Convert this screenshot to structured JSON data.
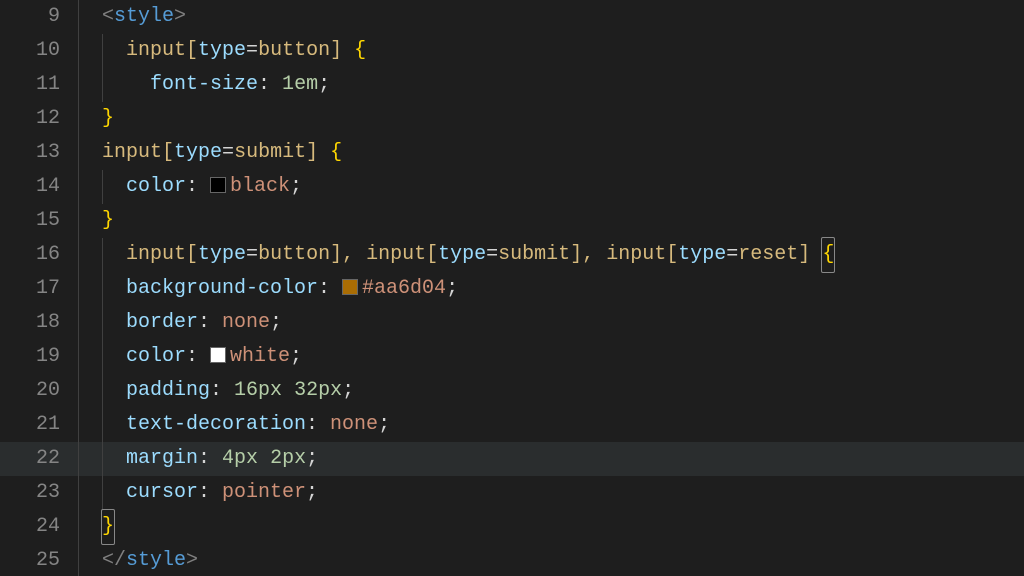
{
  "editor": {
    "activeLine": 22,
    "colors": {
      "bg": "#1e1e1e",
      "gutter": "#858585",
      "tag": "#808080",
      "tagname": "#569cd6",
      "selector": "#d7ba7d",
      "brace": "#ffd700",
      "property": "#9cdcfe",
      "number": "#b5cea8",
      "value": "#ce9178",
      "swatchBlack": "#000000",
      "swatchOrange": "#aa6d04",
      "swatchWhite": "#ffffff"
    }
  },
  "lines": {
    "9": {
      "num": "9",
      "tok": {
        "lt": "<",
        "tag": "style",
        "gt": ">"
      }
    },
    "10": {
      "num": "10",
      "tok": {
        "sel": "input",
        "lb": "[",
        "attr": "type",
        "eq": "=",
        "val": "button",
        "rb": "]",
        "sp": " ",
        "ob": "{"
      }
    },
    "11": {
      "num": "11",
      "tok": {
        "prop": "font-size",
        "colon": ": ",
        "num": "1",
        "unit": "em",
        "semi": ";"
      }
    },
    "12": {
      "num": "12",
      "tok": {
        "cb": "}"
      }
    },
    "13": {
      "num": "13",
      "tok": {
        "sel": "input",
        "lb": "[",
        "attr": "type",
        "eq": "=",
        "val": "submit",
        "rb": "]",
        "sp": " ",
        "ob": "{"
      }
    },
    "14": {
      "num": "14",
      "tok": {
        "prop": "color",
        "colon": ": ",
        "swatch": "black",
        "val": "black",
        "semi": ";"
      }
    },
    "15": {
      "num": "15",
      "tok": {
        "cb": "}"
      }
    },
    "16": {
      "num": "16",
      "tok": {
        "sel1": "input",
        "lb1": "[",
        "attr1": "type",
        "eq1": "=",
        "val1": "button",
        "rb1": "]",
        "c1": ", ",
        "sel2": "input",
        "lb2": "[",
        "attr2": "type",
        "eq2": "=",
        "val2": "submit",
        "rb2": "]",
        "c2": ", ",
        "sel3": "input",
        "lb3": "[",
        "attr3": "type",
        "eq3": "=",
        "val3": "reset",
        "rb3": "]",
        "sp": " ",
        "ob": "{"
      }
    },
    "17": {
      "num": "17",
      "tok": {
        "prop": "background-color",
        "colon": ": ",
        "swatch": "aa6d04",
        "val": "#aa6d04",
        "semi": ";"
      }
    },
    "18": {
      "num": "18",
      "tok": {
        "prop": "border",
        "colon": ": ",
        "val": "none",
        "semi": ";"
      }
    },
    "19": {
      "num": "19",
      "tok": {
        "prop": "color",
        "colon": ": ",
        "swatch": "white",
        "val": "white",
        "semi": ";"
      }
    },
    "20": {
      "num": "20",
      "tok": {
        "prop": "padding",
        "colon": ": ",
        "n1": "16",
        "u1": "px",
        "sp": " ",
        "n2": "32",
        "u2": "px",
        "semi": ";"
      }
    },
    "21": {
      "num": "21",
      "tok": {
        "prop": "text-decoration",
        "colon": ": ",
        "val": "none",
        "semi": ";"
      }
    },
    "22": {
      "num": "22",
      "tok": {
        "prop": "margin",
        "colon": ": ",
        "n1": "4",
        "u1": "px",
        "sp": " ",
        "n2": "2",
        "u2": "px",
        "semi": ";"
      }
    },
    "23": {
      "num": "23",
      "tok": {
        "prop": "cursor",
        "colon": ": ",
        "val": "pointer",
        "semi": ";"
      }
    },
    "24": {
      "num": "24",
      "tok": {
        "cb": "}"
      }
    },
    "25": {
      "num": "25",
      "tok": {
        "lt": "</",
        "tag": "style",
        "gt": ">"
      }
    }
  }
}
